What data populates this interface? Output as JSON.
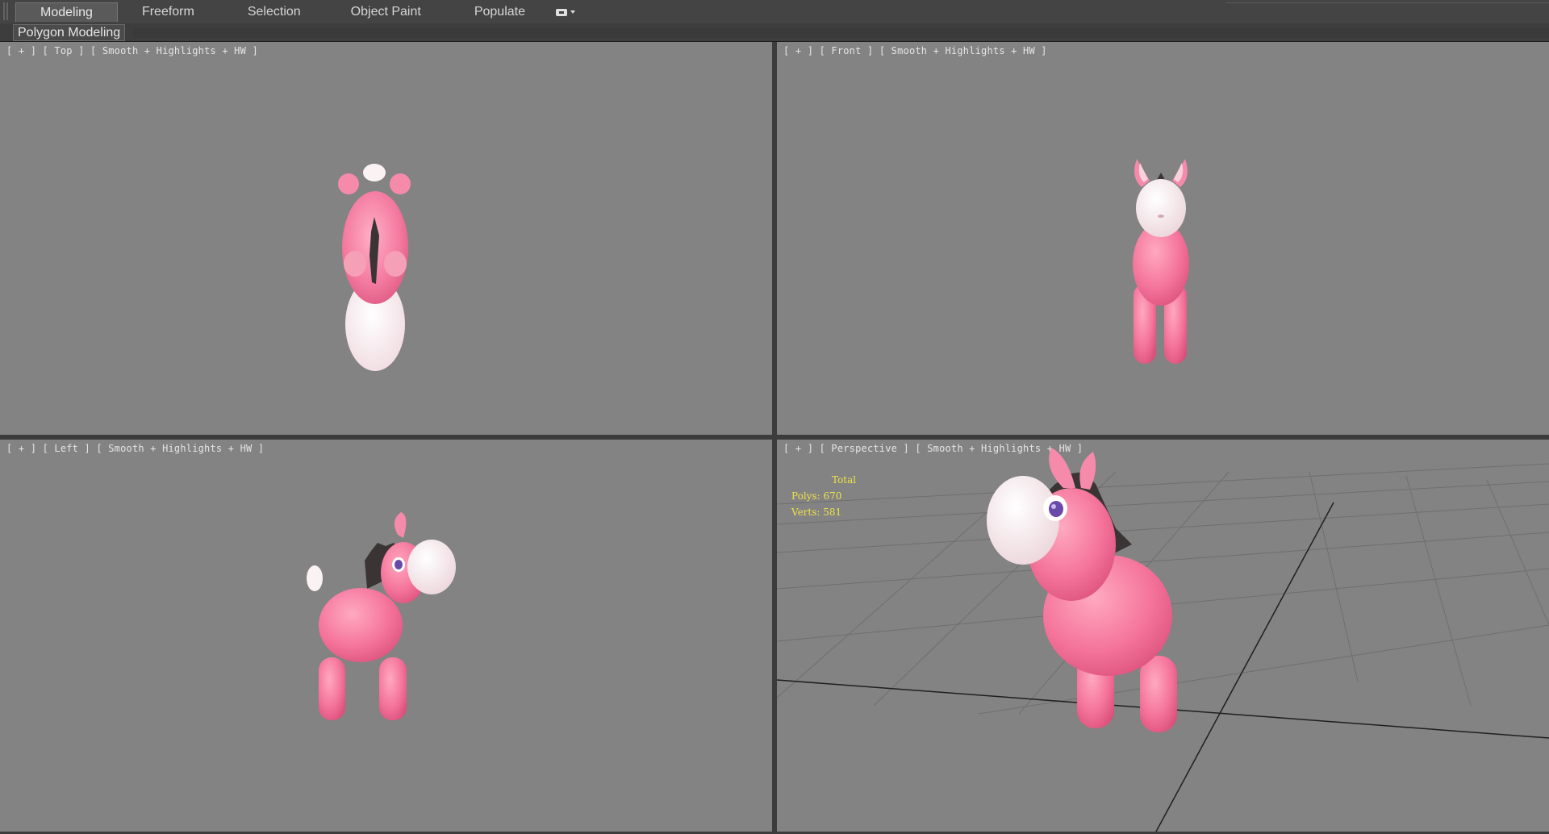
{
  "ribbon": {
    "tabs": [
      "Modeling",
      "Freeform",
      "Selection",
      "Object Paint",
      "Populate"
    ],
    "active_tab": "Modeling",
    "more_icon": "display-toggle-icon",
    "panel_label": "Polygon Modeling"
  },
  "viewports": {
    "top": {
      "plus": "[ + ]",
      "view": "[ Top ]",
      "shading": "[ Smooth + Highlights + HW ]"
    },
    "front": {
      "plus": "[ + ]",
      "view": "[ Front ]",
      "shading": "[ Smooth + Highlights + HW ]"
    },
    "left": {
      "plus": "[ + ]",
      "view": "[ Left ]",
      "shading": "[ Smooth + Highlights + HW ]"
    },
    "perspective": {
      "plus": "[ + ]",
      "view": "[ Perspective ]",
      "shading": "[ Smooth + Highlights + HW ]",
      "stats": {
        "total_label": "Total",
        "polys": "Polys: 670",
        "verts": "Verts: 581"
      }
    }
  },
  "colors": {
    "viewport_bg": "#838383",
    "model_pink": "#f47aa0",
    "model_white": "#fbf2f4",
    "mane": "#3a3434",
    "stats_text": "#f0e14a"
  }
}
